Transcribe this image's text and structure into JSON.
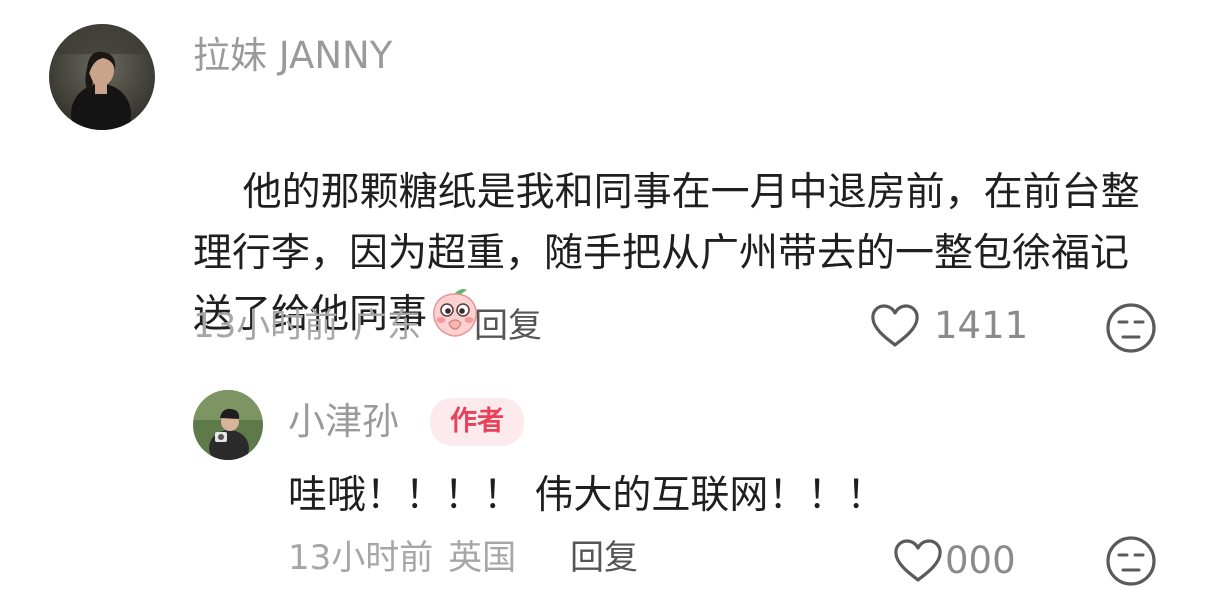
{
  "comments": [
    {
      "username": "拉妹 JANNY",
      "text": "他的那颗糖纸是我和同事在一月中退房前，在前台整理行李，因为超重，随手把从广州带去的一整包徐福记送了给他同事",
      "time": "13小时前",
      "location": "广东",
      "reply_label": "回复",
      "likes": "1411",
      "emoji_icon": "shy-peach-emoji"
    },
    {
      "username": "小津孙",
      "badge": "作者",
      "text": "哇哦！！！！ 伟大的互联网！！！",
      "time": "13小时前",
      "location": "英国",
      "reply_label": "回复",
      "likes": "000"
    }
  ],
  "colors": {
    "username": "#9a9a9a",
    "meta": "#a6a6a6",
    "badge_text": "#e8415a",
    "badge_bg": "#fdeaec"
  }
}
